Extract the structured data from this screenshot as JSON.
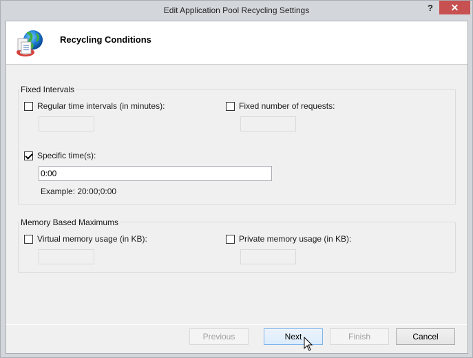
{
  "window": {
    "title": "Edit Application Pool Recycling Settings",
    "help_label": "?",
    "close_label": "✕"
  },
  "header": {
    "title": "Recycling Conditions",
    "icon": "recycle-globe-icon"
  },
  "fixed_intervals": {
    "legend": "Fixed Intervals",
    "regular_time": {
      "label": "Regular time intervals (in minutes):",
      "checked": false,
      "value": ""
    },
    "fixed_requests": {
      "label": "Fixed number of requests:",
      "checked": false,
      "value": ""
    },
    "specific_times": {
      "label": "Specific time(s):",
      "checked": true,
      "value": "0:00"
    },
    "example": "Example: 20:00;0:00"
  },
  "memory_maximums": {
    "legend": "Memory Based Maximums",
    "virtual_memory": {
      "label": "Virtual memory usage (in KB):",
      "checked": false,
      "value": ""
    },
    "private_memory": {
      "label": "Private memory usage (in KB):",
      "checked": false,
      "value": ""
    }
  },
  "buttons": {
    "previous": "Previous",
    "next": "Next",
    "finish": "Finish",
    "cancel": "Cancel"
  }
}
